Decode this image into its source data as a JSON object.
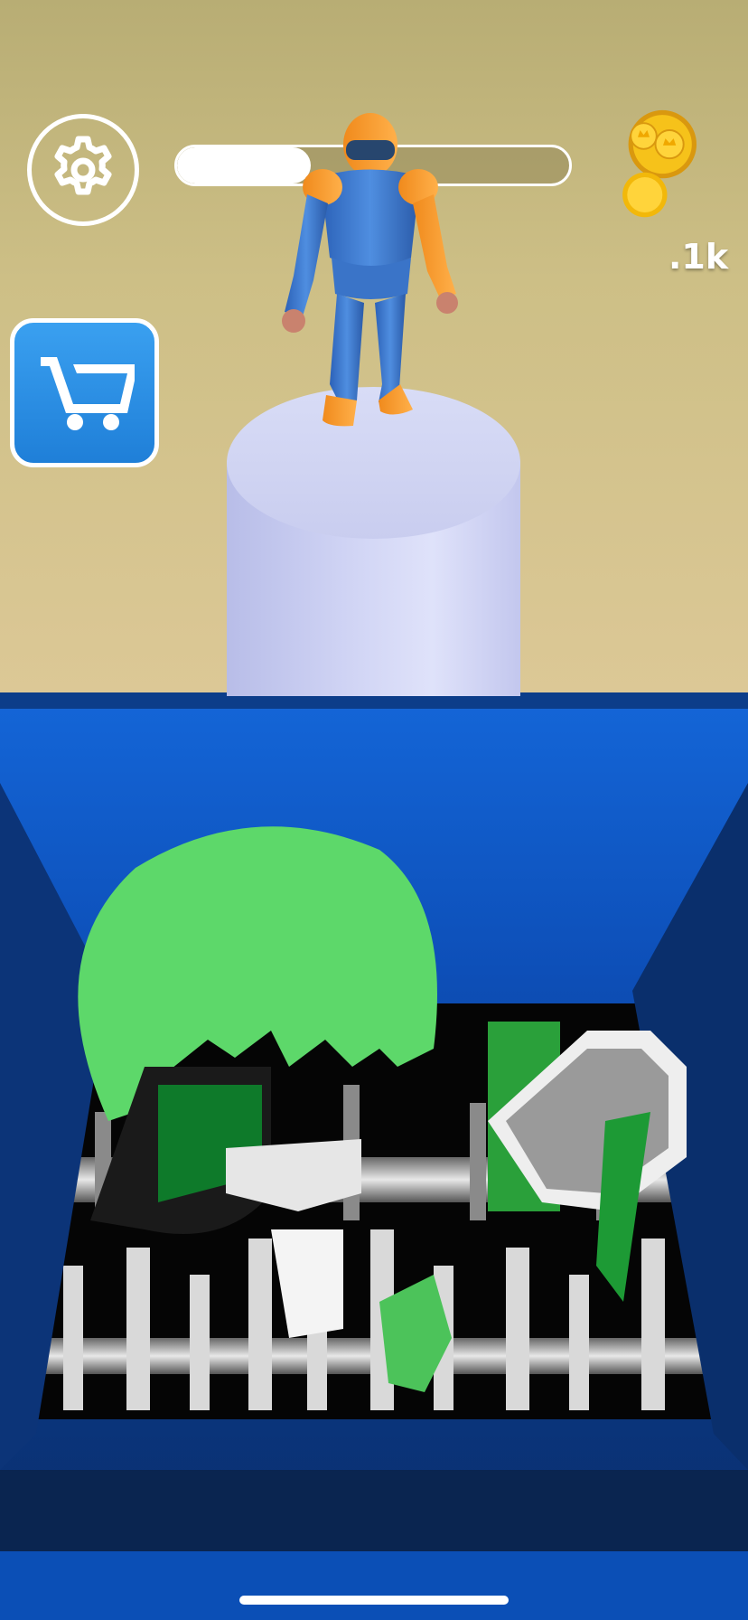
{
  "hud": {
    "progress_fraction": 0.34,
    "coin_count": ".1k"
  },
  "icons": {
    "settings": "gear-icon",
    "shop": "shopping-cart-icon",
    "coins": "gold-coin-icon"
  },
  "colors": {
    "sky": "#c9bb82",
    "shop_button": "#2a8ee6",
    "shredder": "#0d4fb8",
    "coin_gold": "#f6c21a"
  }
}
